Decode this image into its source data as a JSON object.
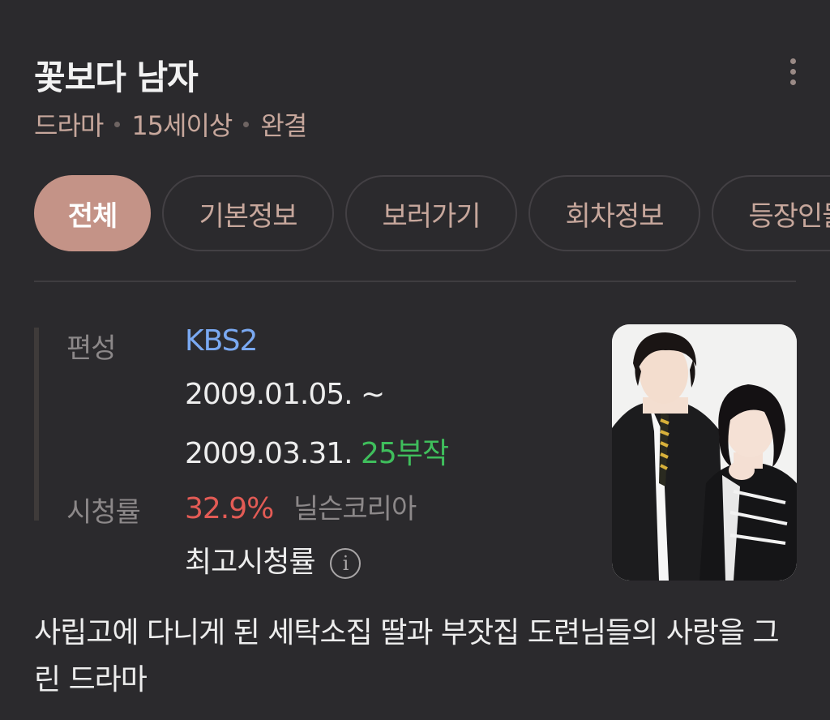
{
  "header": {
    "title": "꽃보다 남자",
    "meta": [
      "드라마",
      "15세이상",
      "완결"
    ]
  },
  "tabs": [
    {
      "label": "전체",
      "active": true
    },
    {
      "label": "기본정보",
      "active": false
    },
    {
      "label": "보러가기",
      "active": false
    },
    {
      "label": "회차정보",
      "active": false
    },
    {
      "label": "등장인물",
      "active": false
    }
  ],
  "info": {
    "broadcast_label": "편성",
    "broadcaster": "KBS2",
    "date_start": "2009.01.05. ~",
    "date_end": "2009.03.31.",
    "episodes": "25부작",
    "rating_label": "시청률",
    "rating_value": "32.9%",
    "rating_source": "닐슨코리아",
    "rating_note": "최고시청률",
    "info_icon": "i"
  },
  "poster": {
    "icon": "drama-poster-image"
  },
  "description": "사립고에 다니게 된 세탁소집 딸과 부잣집 도련님들의 사랑을 그린 드라마",
  "colors": {
    "background": "#2b2a2d",
    "accent": "#c49387",
    "link": "#7aa9f2",
    "episodes": "#3fbe5c",
    "rating": "#e35b55"
  }
}
